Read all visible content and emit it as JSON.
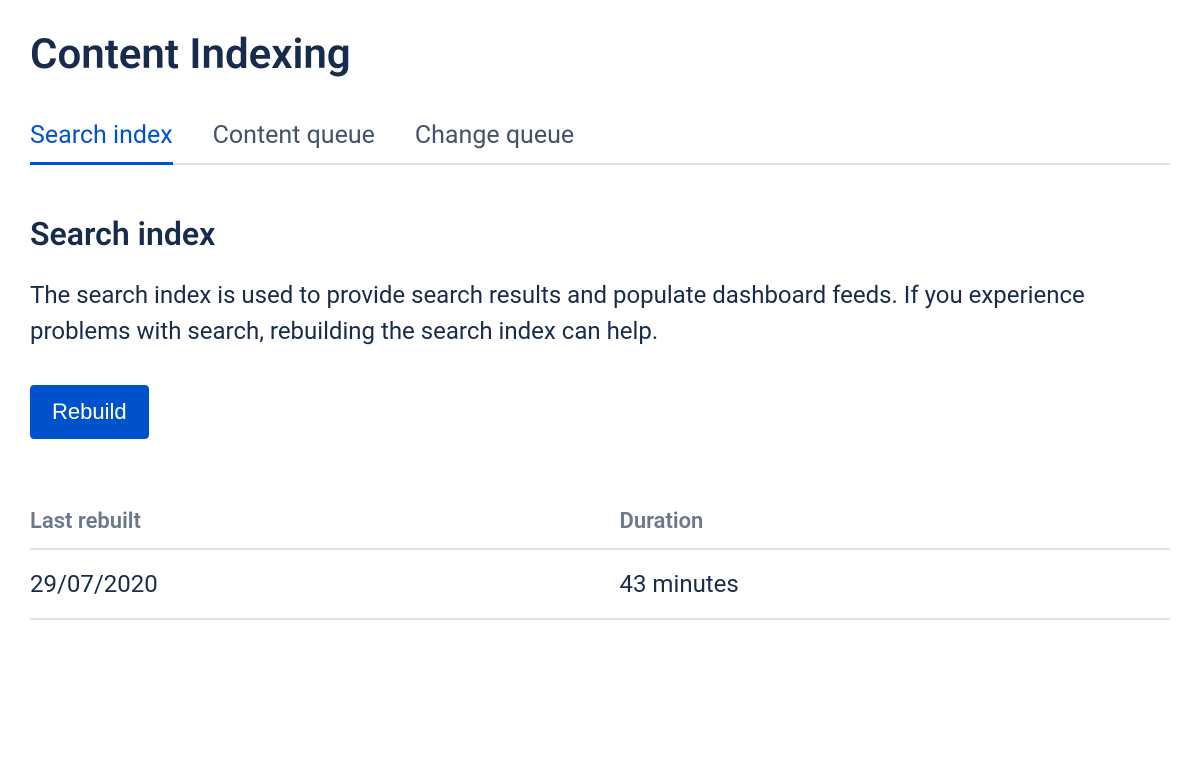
{
  "page": {
    "title": "Content Indexing"
  },
  "tabs": [
    {
      "label": "Search index",
      "active": true
    },
    {
      "label": "Content queue",
      "active": false
    },
    {
      "label": "Change queue",
      "active": false
    }
  ],
  "section": {
    "title": "Search index",
    "description": "The search index is used to provide search results and populate dashboard feeds. If you experience problems with search, rebuilding the search index can help.",
    "rebuild_label": "Rebuild"
  },
  "table": {
    "headers": {
      "last_rebuilt": "Last rebuilt",
      "duration": "Duration"
    },
    "row": {
      "last_rebuilt": "29/07/2020",
      "duration": "43 minutes"
    }
  }
}
